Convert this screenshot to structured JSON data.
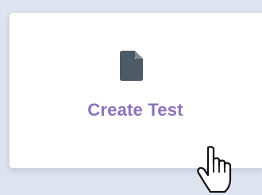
{
  "card": {
    "label": "Create Test",
    "icon": "document-icon"
  },
  "cursor": {
    "icon": "hand-pointer-icon"
  },
  "colors": {
    "background": "#dde4f0",
    "card": "#ffffff",
    "icon": "#4d5b66",
    "label": "#8c72bd"
  }
}
